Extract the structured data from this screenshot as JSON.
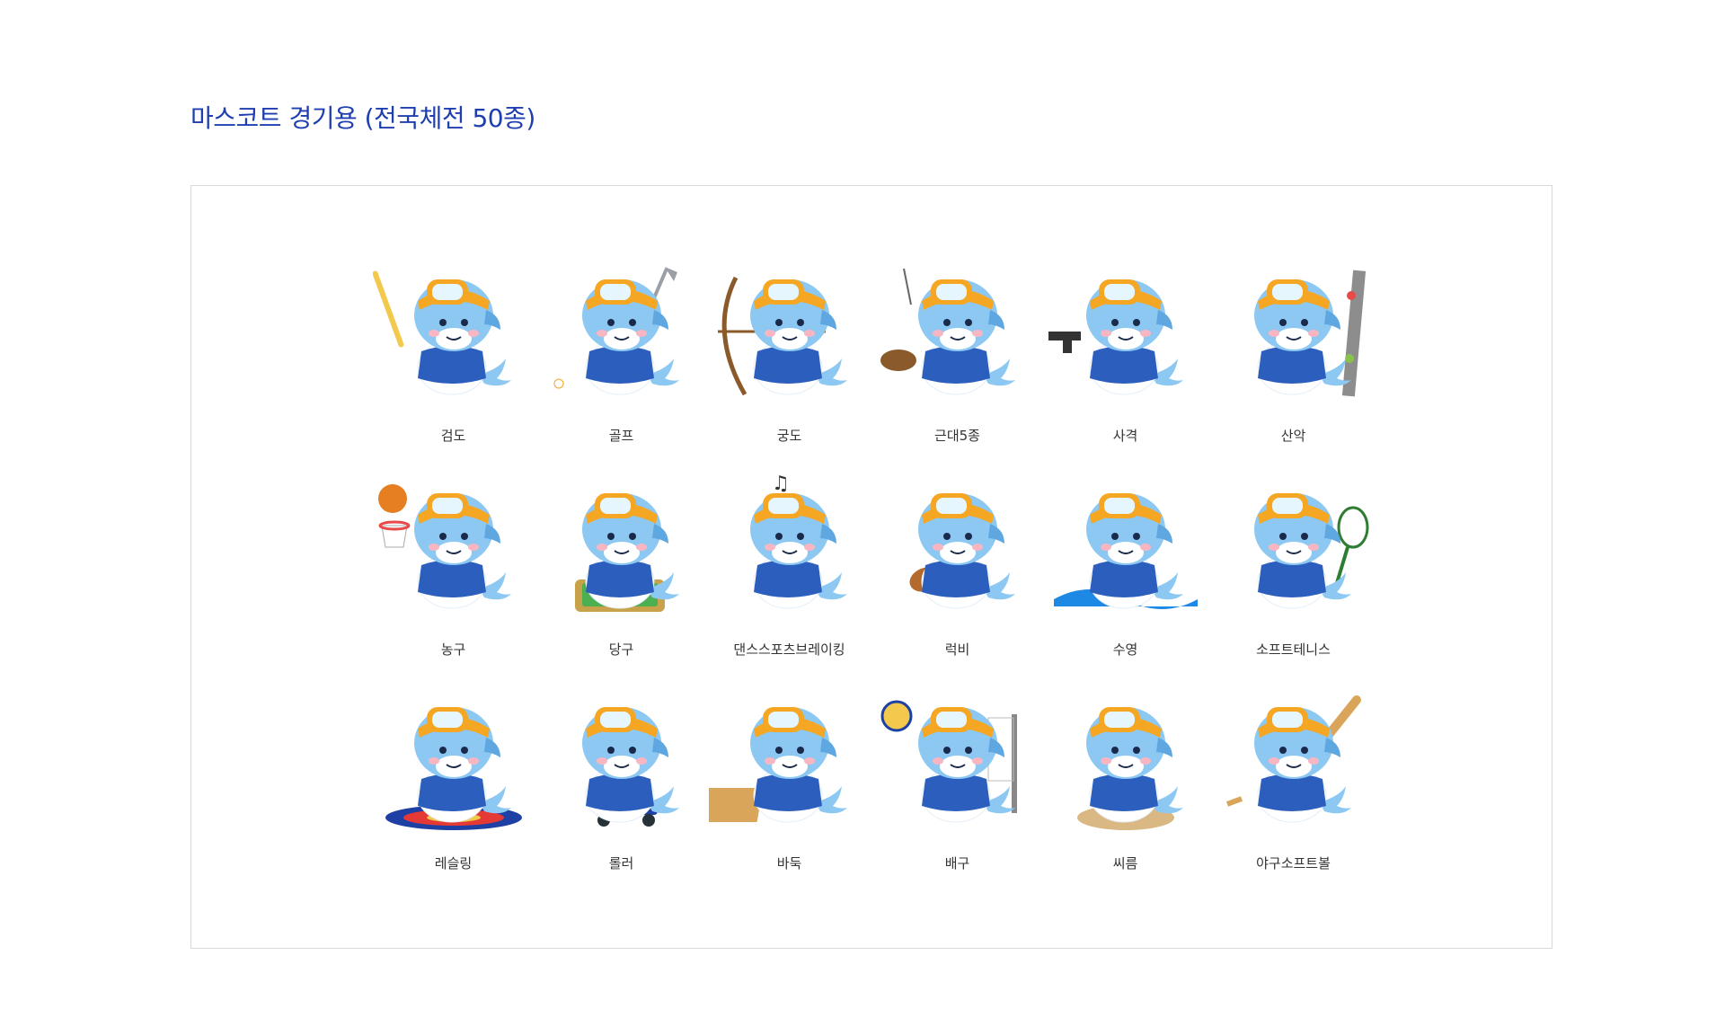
{
  "page_title": "마스코트 경기용 (전국체전 50종)",
  "colors": {
    "title": "#1f3fb0",
    "body": "#8cc8f2",
    "body_dark": "#5fa7e0",
    "goggle": "#f5a623",
    "lens": "#e6f6ff",
    "shirt": "#2c5fbd",
    "cheek": "#f7b6c2",
    "label": "#333333"
  },
  "mascots": [
    {
      "label": "검도",
      "prop_icon": "bamboo-sword-icon"
    },
    {
      "label": "골프",
      "prop_icon": "golf-club-icon"
    },
    {
      "label": "궁도",
      "prop_icon": "bow-and-arrow-icon"
    },
    {
      "label": "근대5종",
      "prop_icon": "horse-and-fencing-icon"
    },
    {
      "label": "사격",
      "prop_icon": "pistol-icon"
    },
    {
      "label": "산악",
      "prop_icon": "climbing-wall-icon"
    },
    {
      "label": "농구",
      "prop_icon": "basketball-hoop-icon"
    },
    {
      "label": "당구",
      "prop_icon": "billiard-table-icon"
    },
    {
      "label": "댄스스포츠브레이킹",
      "prop_icon": "music-note-icon"
    },
    {
      "label": "럭비",
      "prop_icon": "rugby-ball-icon"
    },
    {
      "label": "수영",
      "prop_icon": "water-splash-icon"
    },
    {
      "label": "소프트테니스",
      "prop_icon": "tennis-racket-icon"
    },
    {
      "label": "레슬링",
      "prop_icon": "wrestling-mat-icon"
    },
    {
      "label": "롤러",
      "prop_icon": "roller-skate-icon"
    },
    {
      "label": "바둑",
      "prop_icon": "go-board-icon"
    },
    {
      "label": "배구",
      "prop_icon": "volleyball-net-icon"
    },
    {
      "label": "씨름",
      "prop_icon": "sand-ring-icon"
    },
    {
      "label": "야구소프트볼",
      "prop_icon": "baseball-bat-icon"
    }
  ]
}
